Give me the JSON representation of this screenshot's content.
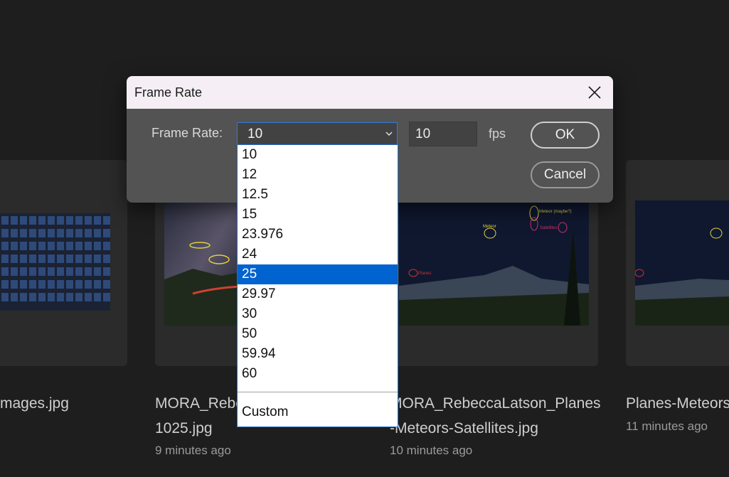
{
  "dialog": {
    "title": "Frame Rate",
    "field_label": "Frame Rate:",
    "selected_value": "10",
    "fps_value": "10",
    "fps_unit": "fps",
    "ok_label": "OK",
    "cancel_label": "Cancel"
  },
  "dropdown": {
    "options": [
      "10",
      "12",
      "12.5",
      "15",
      "23.976",
      "24",
      "25",
      "29.97",
      "30",
      "50",
      "59.94",
      "60"
    ],
    "highlighted": "25",
    "custom_label": "Custom"
  },
  "files": [
    {
      "name_line1": "mages.jpg",
      "name_line2": "",
      "time": ""
    },
    {
      "name_line1": "MORA_Rebe",
      "name_line2": "1025.jpg",
      "time": "9 minutes ago"
    },
    {
      "name_line1": "MORA_RebeccaLatson_Planes",
      "name_line2": "-Meteors-Satellites.jpg",
      "time": "10 minutes ago"
    },
    {
      "name_line1": "Planes-Meteors",
      "name_line2": "",
      "time": "11 minutes ago"
    }
  ],
  "thumbnail_annotations": {
    "meteor": "Meteor",
    "meteor_maybe": "Meteor (maybe?)",
    "satellites": "Satellites",
    "planes": "Planes"
  },
  "colors": {
    "accent": "#0063cf",
    "dialog_bg": "#535353",
    "titlebar_bg": "#f5eef4",
    "page_bg": "#1e1e1e"
  }
}
